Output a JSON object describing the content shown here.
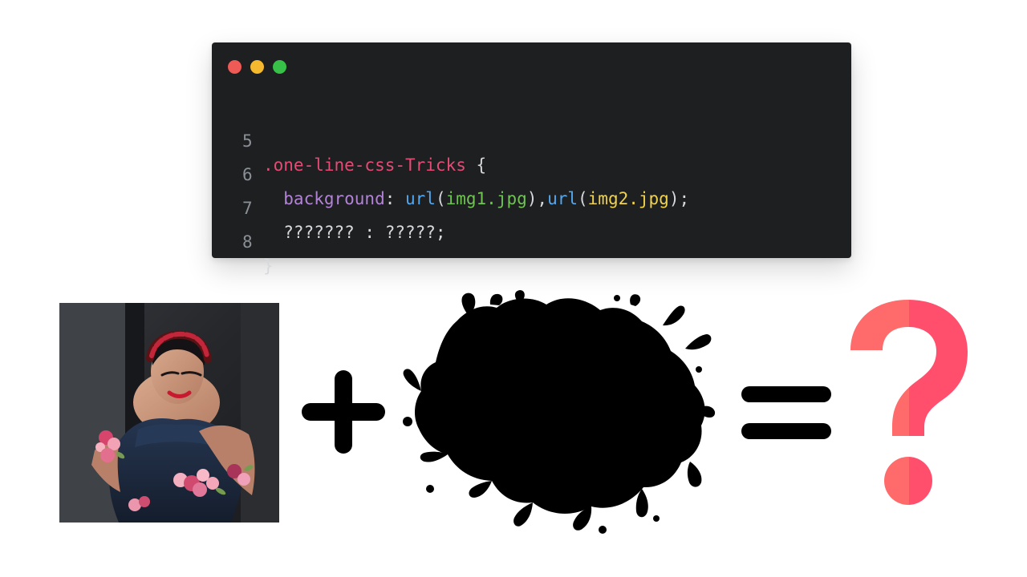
{
  "code_window": {
    "traffic_lights": [
      {
        "name": "close",
        "color": "#ee5a55"
      },
      {
        "name": "minimize",
        "color": "#f5b92f"
      },
      {
        "name": "maximize",
        "color": "#38c148"
      }
    ],
    "lines": [
      {
        "number": "5",
        "tokens": [
          {
            "text": ".one-line-css-Tricks",
            "kind": "selector"
          },
          {
            "text": " {",
            "kind": "punc"
          }
        ]
      },
      {
        "number": "6",
        "tokens": [
          {
            "text": "  background",
            "kind": "prop"
          },
          {
            "text": ": ",
            "kind": "punc"
          },
          {
            "text": "url",
            "kind": "func"
          },
          {
            "text": "(",
            "kind": "punc"
          },
          {
            "text": "img1.jpg",
            "kind": "str1"
          },
          {
            "text": "),",
            "kind": "punc"
          },
          {
            "text": "url",
            "kind": "func"
          },
          {
            "text": "(",
            "kind": "punc"
          },
          {
            "text": "img2.jpg",
            "kind": "str2"
          },
          {
            "text": ");",
            "kind": "punc"
          }
        ]
      },
      {
        "number": "7",
        "tokens": [
          {
            "text": "  ??????? : ?????;",
            "kind": "plain"
          }
        ]
      },
      {
        "number": "8",
        "tokens": [
          {
            "text": "}",
            "kind": "punc"
          }
        ]
      }
    ]
  },
  "equation": {
    "operand_1": "photo-portrait",
    "operator_1": "plus-icon",
    "operand_2": "ink-splash-icon",
    "operator_2": "equals-icon",
    "result": "question-mark-icon",
    "colors": {
      "symbol": "#000000",
      "question_left": "#ff6b6b",
      "question_right": "#ff4f6d"
    }
  }
}
